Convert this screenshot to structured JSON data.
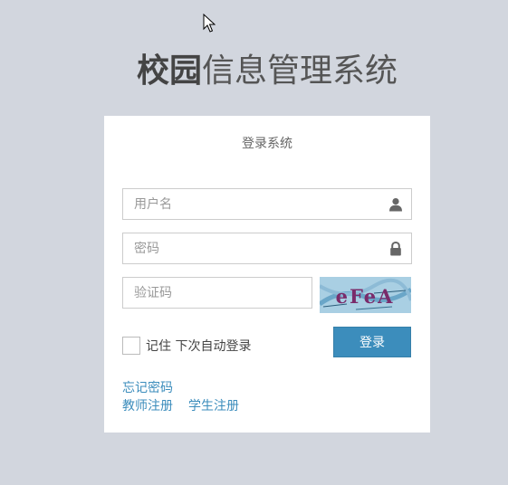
{
  "title": {
    "bold": "校园",
    "light": "信息管理系统"
  },
  "card": {
    "heading": "登录系统"
  },
  "form": {
    "username_placeholder": "用户名",
    "password_placeholder": "密码",
    "captcha_placeholder": "验证码",
    "captcha_text": "eFeA",
    "remember_label": "记住 下次自动登录",
    "login_button": "登录"
  },
  "links": {
    "forgot_password": "忘记密码",
    "teacher_register": "教师注册",
    "student_register": "学生注册"
  },
  "colors": {
    "background": "#d2d6de",
    "primary": "#3c8dbc",
    "card": "#ffffff"
  }
}
